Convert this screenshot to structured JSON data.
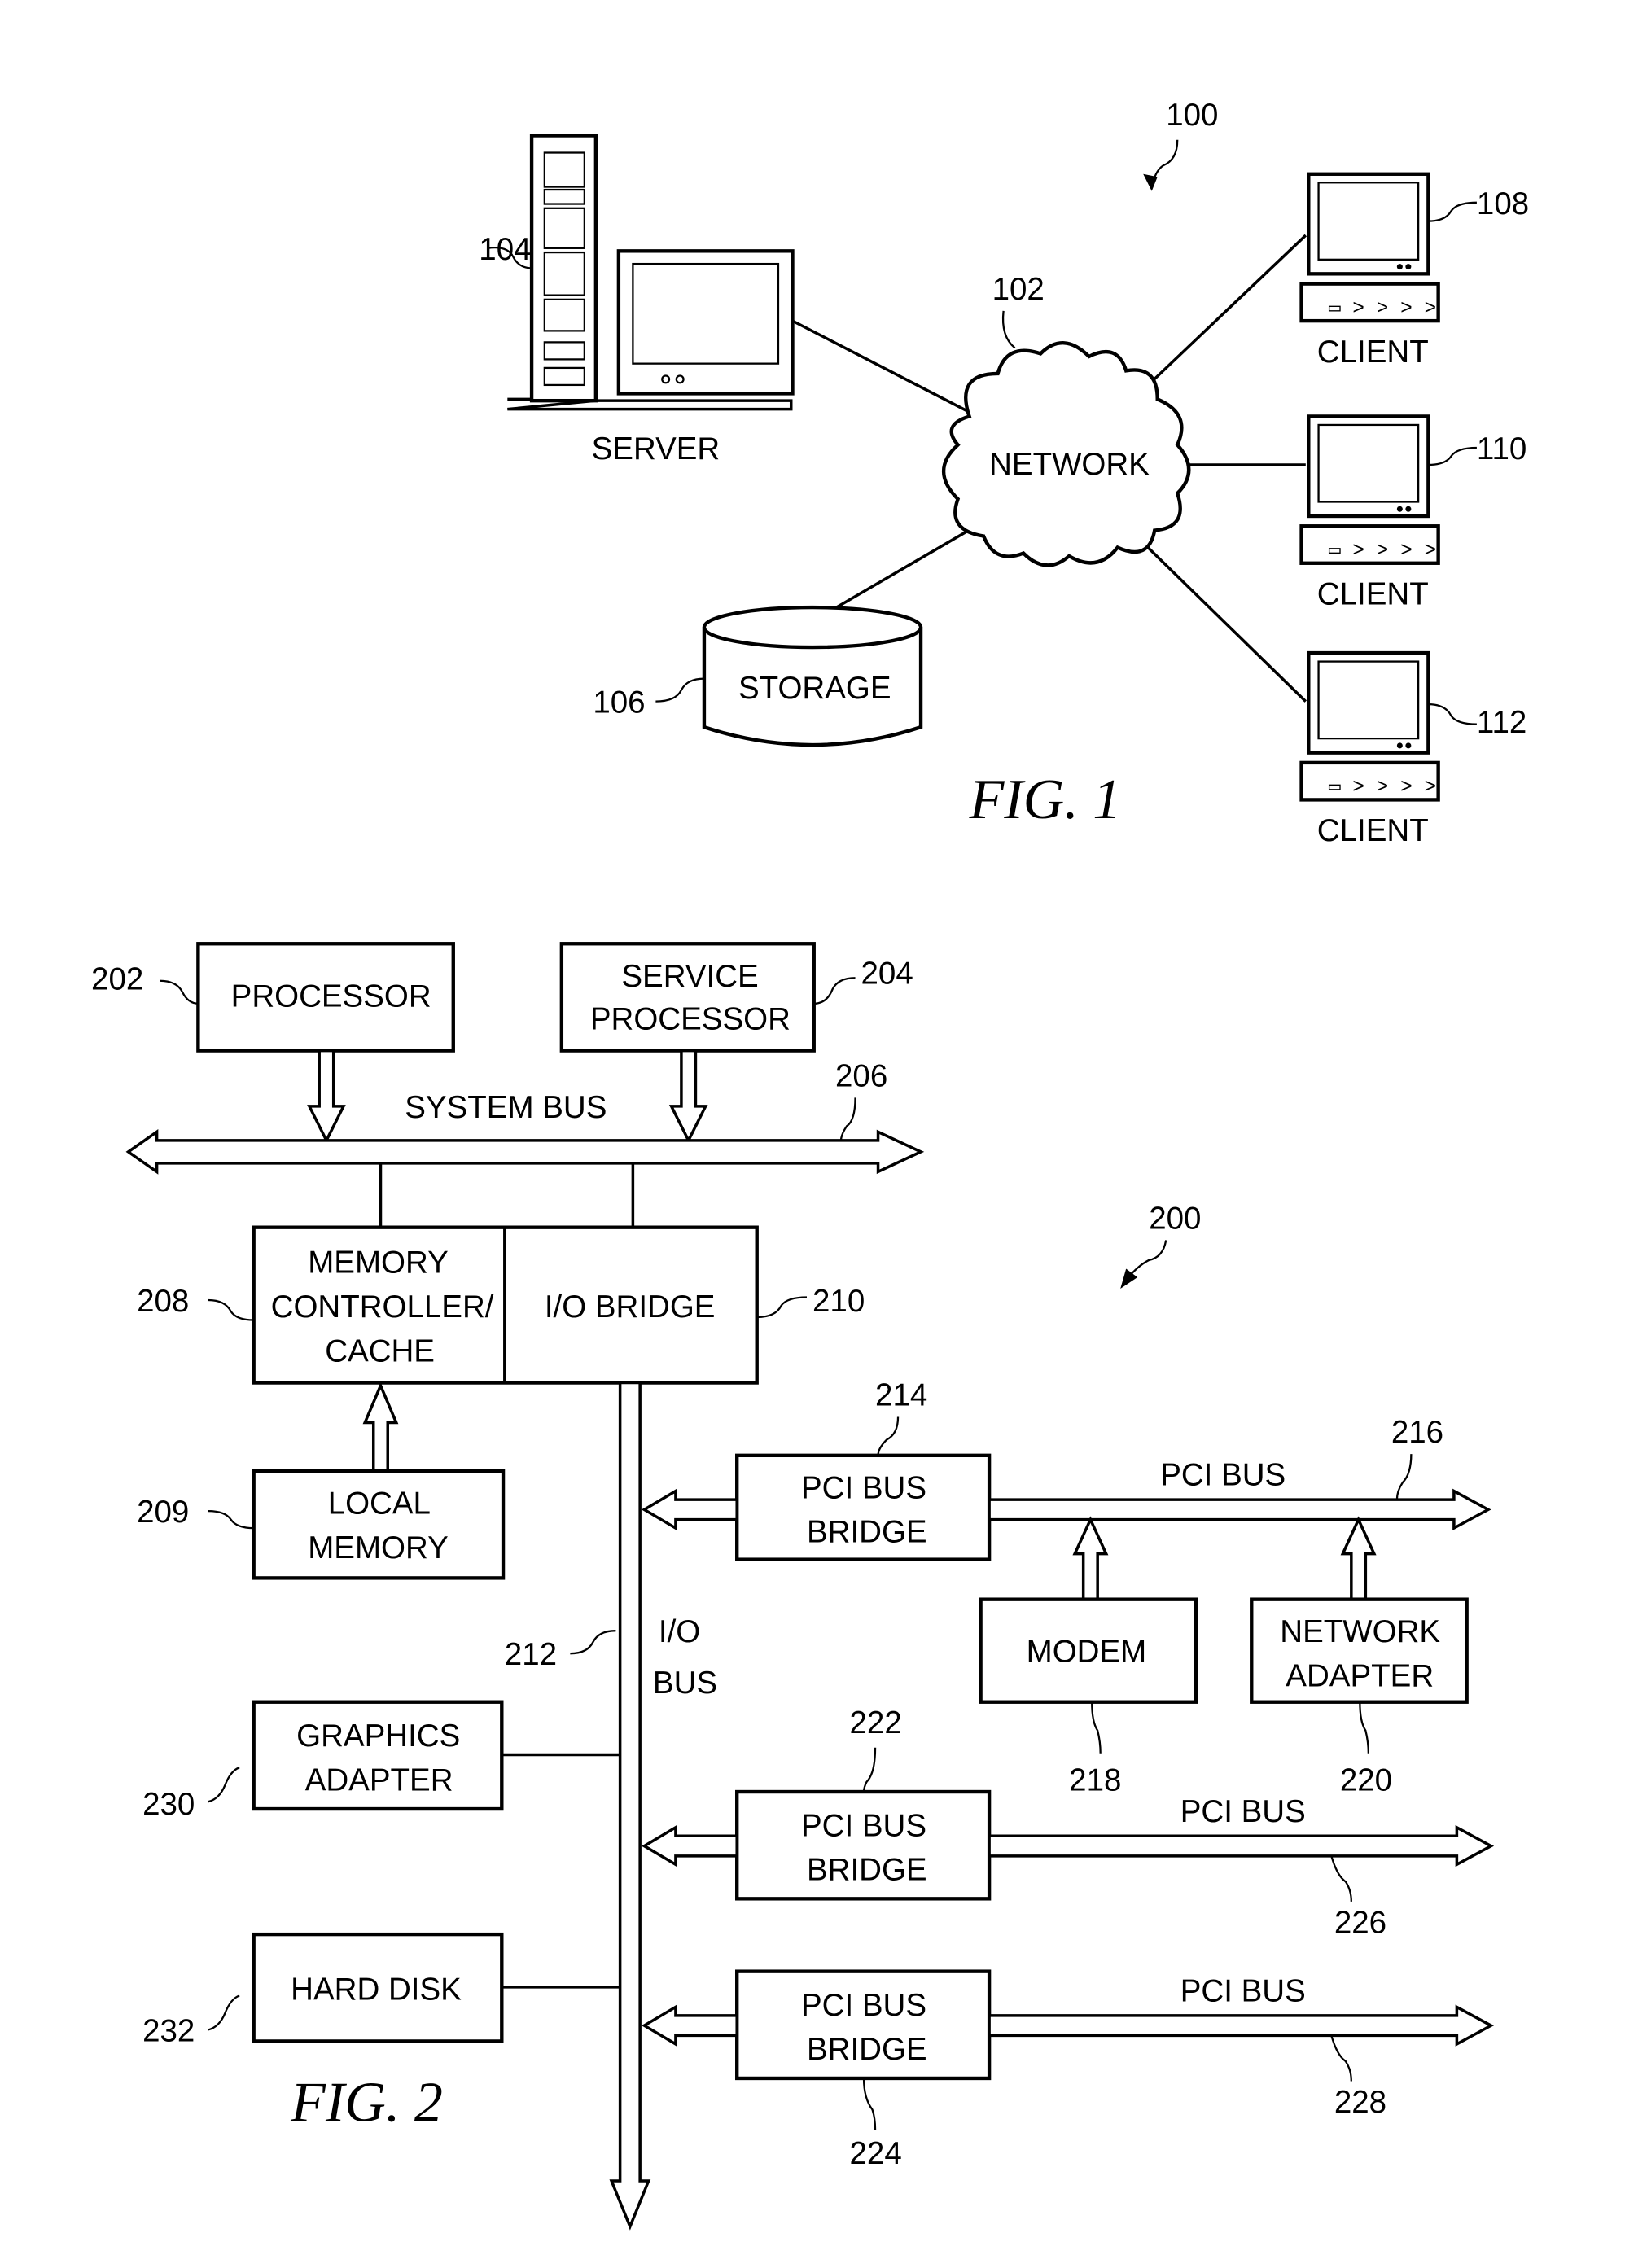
{
  "fig1": {
    "caption": "FIG. 1",
    "ref_system": "100",
    "network": {
      "ref": "102",
      "label": "NETWORK"
    },
    "server": {
      "ref": "104",
      "label": "SERVER"
    },
    "storage": {
      "ref": "106",
      "label": "STORAGE"
    },
    "clients": [
      {
        "ref": "108",
        "label": "CLIENT"
      },
      {
        "ref": "110",
        "label": "CLIENT"
      },
      {
        "ref": "112",
        "label": "CLIENT"
      }
    ]
  },
  "fig2": {
    "caption": "FIG. 2",
    "ref_system": "200",
    "processor": {
      "ref": "202",
      "label": "PROCESSOR"
    },
    "service_processor": {
      "ref": "204",
      "lines": [
        "SERVICE",
        "PROCESSOR"
      ]
    },
    "system_bus": {
      "ref": "206",
      "label": "SYSTEM BUS"
    },
    "memory_controller": {
      "ref": "208",
      "lines": [
        "MEMORY",
        "CONTROLLER/",
        "CACHE"
      ]
    },
    "local_memory": {
      "ref": "209",
      "lines": [
        "LOCAL",
        "MEMORY"
      ]
    },
    "io_bridge": {
      "ref": "210",
      "label": "I/O BRIDGE"
    },
    "io_bus": {
      "ref": "212",
      "lines": [
        "I/O",
        "BUS"
      ]
    },
    "pci_bridge_1": {
      "ref": "214",
      "lines": [
        "PCI BUS",
        "BRIDGE"
      ]
    },
    "pci_bus_1": {
      "ref": "216",
      "label": "PCI BUS"
    },
    "modem": {
      "ref": "218",
      "label": "MODEM"
    },
    "network_adapter": {
      "ref": "220",
      "lines": [
        "NETWORK",
        "ADAPTER"
      ]
    },
    "pci_bridge_2": {
      "ref": "222",
      "lines": [
        "PCI BUS",
        "BRIDGE"
      ]
    },
    "pci_bridge_3": {
      "ref": "224",
      "lines": [
        "PCI BUS",
        "BRIDGE"
      ]
    },
    "pci_bus_2": {
      "ref": "226",
      "label": "PCI BUS"
    },
    "pci_bus_3": {
      "ref": "228",
      "label": "PCI BUS"
    },
    "graphics_adapter": {
      "ref": "230",
      "lines": [
        "GRAPHICS",
        "ADAPTER"
      ]
    },
    "hard_disk": {
      "ref": "232",
      "label": "HARD DISK"
    }
  }
}
